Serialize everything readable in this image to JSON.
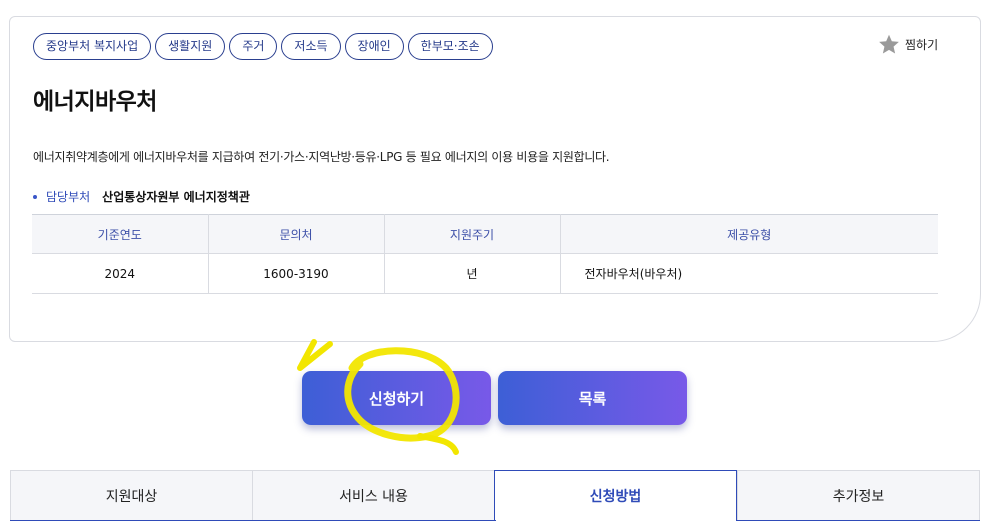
{
  "tags": [
    "중앙부처 복지사업",
    "생활지원",
    "주거",
    "저소득",
    "장애인",
    "한부모·조손"
  ],
  "favorite": {
    "label": "찜하기",
    "icon": "star-icon"
  },
  "title": "에너지바우처",
  "description": "에너지취약계층에게 에너지바우처를 지급하여 전기·가스·지역난방·등유·LPG 등 필요 에너지의 이용 비용을 지원합니다.",
  "department": {
    "label": "담당부처",
    "value": "산업통상자원부 에너지정책관"
  },
  "info_table": {
    "headers": [
      "기준연도",
      "문의처",
      "지원주기",
      "제공유형"
    ],
    "row": [
      "2024",
      "1600-3190",
      "년",
      "전자바우처(바우처)"
    ]
  },
  "buttons": {
    "apply": "신청하기",
    "list": "목록"
  },
  "tabs": [
    "지원대상",
    "서비스 내용",
    "신청방법",
    "추가정보"
  ],
  "active_tab": "신청방법",
  "colors": {
    "accent": "#2f4bb8",
    "button_start": "#3d5fd6",
    "button_end": "#7859e8",
    "highlight": "#f2e600"
  }
}
